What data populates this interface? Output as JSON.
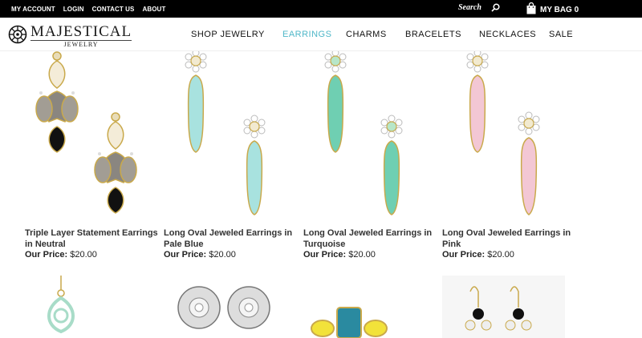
{
  "topbar": {
    "links": [
      "MY ACCOUNT",
      "LOGIN",
      "CONTACT US",
      "ABOUT"
    ],
    "search_placeholder": "Search",
    "bag_label": "MY BAG 0"
  },
  "brand": {
    "name": "MAJESTICAL",
    "sub": "JEWELRY"
  },
  "nav": {
    "items": [
      "SHOP JEWELRY",
      "EARRINGS",
      "CHARMS",
      "BRACELETS",
      "NECKLACES",
      "SALE"
    ],
    "active": "EARRINGS"
  },
  "products": [
    {
      "title": "Triple Layer Statement Earrings in Neutral",
      "price_label": "Our Price:",
      "price": "$20.00"
    },
    {
      "title": "Long Oval Jeweled Earrings in Pale Blue",
      "price_label": "Our Price:",
      "price": "$20.00"
    },
    {
      "title": "Long Oval Jeweled Earrings in Turquoise",
      "price_label": "Our Price:",
      "price": "$20.00"
    },
    {
      "title": "Long Oval Jeweled Earrings in Pink",
      "price_label": "Our Price:",
      "price": "$20.00"
    }
  ],
  "colors": {
    "accent": "#4fb7c8",
    "pale_blue": "#a8e2df",
    "turquoise": "#6fcfb2",
    "pink": "#f3c7d4",
    "gold": "#c9a94b"
  }
}
